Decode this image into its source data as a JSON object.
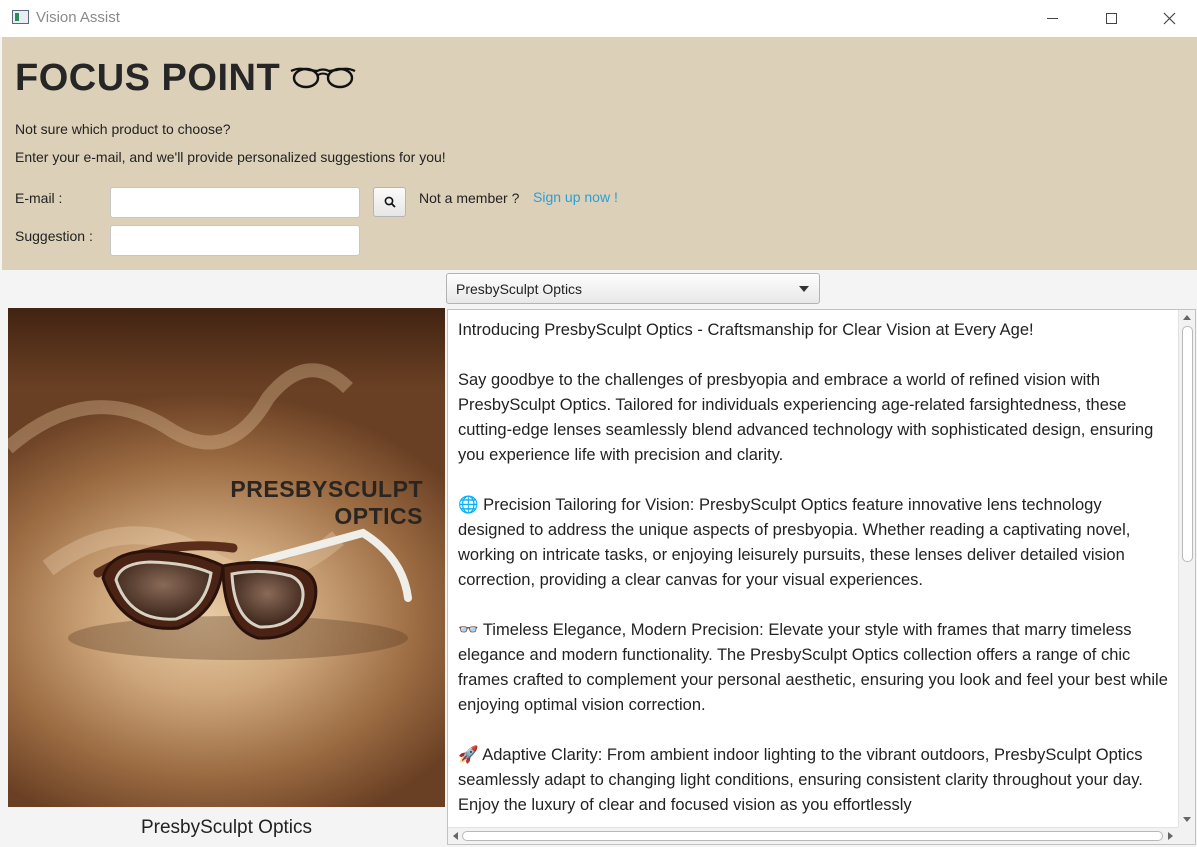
{
  "window": {
    "title": "Vision Assist",
    "icons": {
      "app": "app-window-icon",
      "minimize": "minimize-icon",
      "maximize": "maximize-icon",
      "close": "close-icon"
    }
  },
  "header": {
    "brand": "FOCUS POINT",
    "brand_icon": "glasses-icon",
    "intro_line1": "Not sure which product to choose?",
    "intro_line2": "Enter your e-mail, and we'll provide personalized suggestions for you!",
    "email_label": "E-mail :",
    "email_value": "",
    "suggestion_label": "Suggestion :",
    "suggestion_value": "",
    "search_icon": "search-icon",
    "member_text": "Not a member ?",
    "signup_link": "Sign up now !",
    "colors": {
      "background": "#ddd0b8",
      "link": "#2a9fd6"
    }
  },
  "product_select": {
    "selected": "PresbySculpt Optics"
  },
  "product": {
    "image_text_line1": "PRESBYSCULPT",
    "image_text_line2": "OPTICS",
    "caption": "PresbySculpt Optics"
  },
  "description": {
    "paragraphs": [
      "Introducing PresbySculpt Optics - Craftsmanship for Clear Vision at Every Age!",
      "Say goodbye to the challenges of presbyopia and embrace a world of refined vision with PresbySculpt Optics. Tailored for individuals experiencing age-related farsightedness, these cutting-edge lenses seamlessly blend advanced technology with sophisticated design, ensuring you experience life with precision and clarity.",
      "🌐 Precision Tailoring for Vision: PresbySculpt Optics feature innovative lens technology designed to address the unique aspects of presbyopia. Whether reading a captivating novel, working on intricate tasks, or enjoying leisurely pursuits, these lenses deliver detailed vision correction, providing a clear canvas for your visual experiences.",
      "👓 Timeless Elegance, Modern Precision: Elevate your style with frames that marry timeless elegance and modern functionality. The PresbySculpt Optics collection offers a range of chic frames crafted to complement your personal aesthetic, ensuring you look and feel your best while enjoying optimal vision correction.",
      "🚀 Adaptive Clarity: From ambient indoor lighting to the vibrant outdoors, PresbySculpt Optics seamlessly adapt to changing light conditions, ensuring consistent clarity throughout your day. Enjoy the luxury of clear and focused vision as you effortlessly"
    ]
  }
}
